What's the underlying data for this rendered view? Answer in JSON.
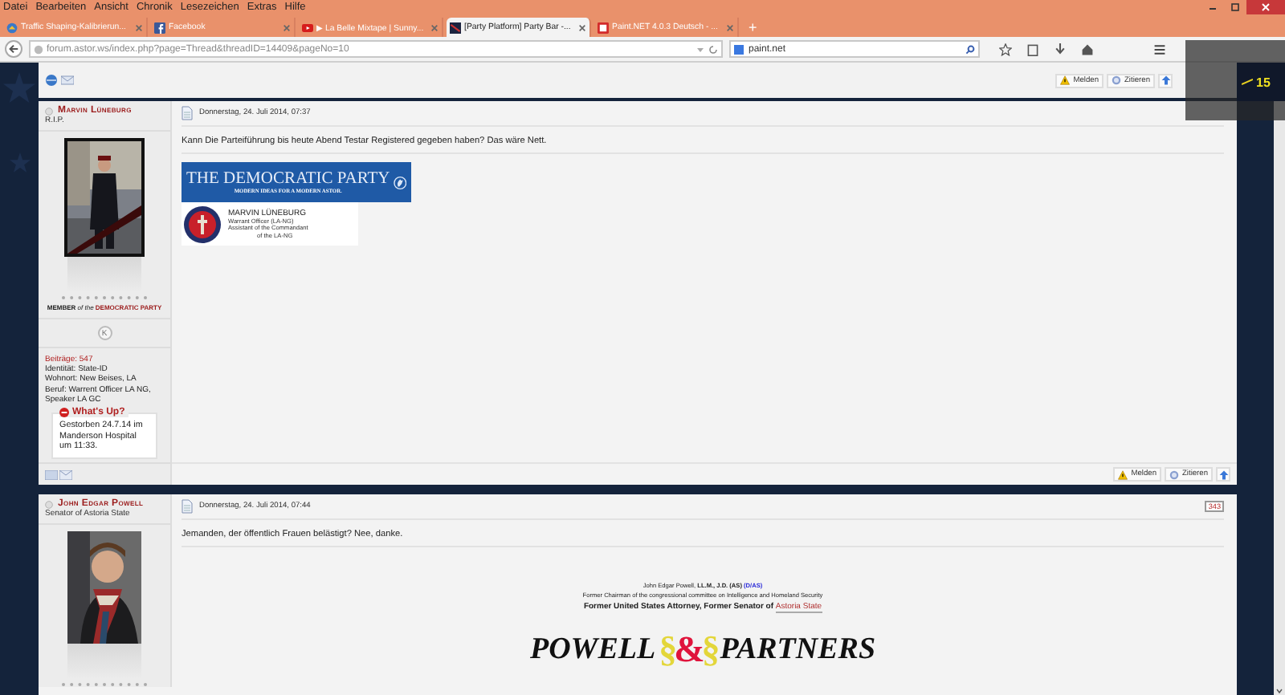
{
  "menu_bar": [
    "Datei",
    "Bearbeiten",
    "Ansicht",
    "Chronik",
    "Lesezeichen",
    "Extras",
    "Hilfe"
  ],
  "tabs": [
    {
      "title": "Traffic Shaping-Kalibrierun...",
      "selected": false
    },
    {
      "title": "Facebook",
      "selected": false
    },
    {
      "title": "▶ La Belle Mixtape | Sunny...",
      "selected": false
    },
    {
      "title": "[Party Platform] Party Bar -...",
      "selected": true
    },
    {
      "title": "Paint.NET 4.0.3 Deutsch - ...",
      "selected": false
    }
  ],
  "new_tab": "+",
  "address_bar": {
    "url": "forum.astor.ws/index.php?page=Thread&threadID=14409&pageNo=10"
  },
  "search_field": {
    "value": "paint.net"
  },
  "overlay": {
    "count": "15"
  },
  "toolbar_buttons": [
    "Melden",
    "Zitieren"
  ],
  "posts": [
    {
      "author": "Marvin Lüneburg",
      "rank": "R.I.P.",
      "member_badge": {
        "prefix": "MEMBER",
        "of": "of the",
        "party": "DEMOCRATIC PARTY"
      },
      "status_letter": "K",
      "profile": [
        {
          "text": "Beiträge: 547",
          "kind": "count"
        },
        {
          "text": "Identität: State-ID",
          "kind": "plain"
        },
        {
          "text": "Wohnort: New Beises, LA",
          "kind": "plain"
        },
        {
          "text": "Beruf: Warrent Officer LA NG, Speaker LA GC",
          "kind": "plain"
        }
      ],
      "whats_up": {
        "title": "What's Up?",
        "text": "Gestorben 24.7.14 im Manderson Hospital um 11:33."
      },
      "date": "Donnerstag, 24. Juli 2014, 07:37",
      "message": "Kann Die Parteiführung bis heute Abend Testar Registered gegeben haben? Das wäre Nett.",
      "signature": {
        "kind": "party",
        "banner_title": "THE DEMOCRATIC PARTY",
        "banner_slogan": "MODERN IDEAS FOR A MODERN ASTOR.",
        "name": "MARVIN LÜNEBURG",
        "lines": [
          "Warrant Officer (LA-NG)",
          "Assistant of the Commandant",
          "of the LA-NG"
        ]
      },
      "buttons": [
        "Melden",
        "Zitieren"
      ]
    },
    {
      "author": "John Edgar Powell",
      "rank": "Senator of Astoria State",
      "post_number": "343",
      "date": "Donnerstag, 24. Juli 2014, 07:44",
      "message": "Jemanden, der öffentlich Frauen belästigt? Nee, danke.",
      "signature": {
        "kind": "firm",
        "line1": "John Edgar Powell, **LL.M., J.D. (AS)**",
        "line1_link": "(D/AS)",
        "line2": "Former Chairman of the congressional committee on Intelligence and Homeland Security",
        "line3": "Former United States Attorney, Former Senator of",
        "line3_link": "Astoria State",
        "logo_left": "POWELL",
        "logo_mark": [
          {
            "text": "§",
            "color": "#e3d63a"
          },
          {
            "text": "&",
            "color": "#e0143c"
          },
          {
            "text": "§",
            "color": "#e3d63a"
          }
        ],
        "logo_right": "PARTNERS"
      }
    }
  ]
}
